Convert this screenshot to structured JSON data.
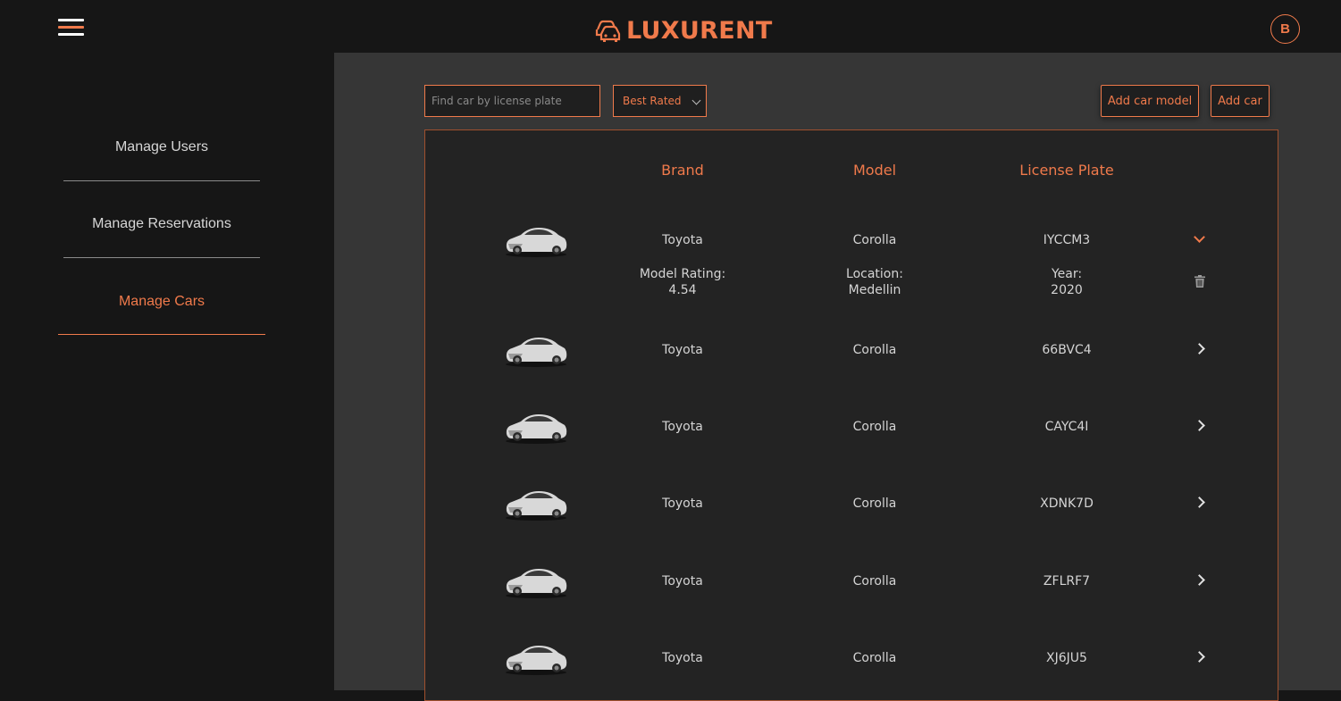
{
  "header": {
    "brand": "LUXURENT",
    "avatar_initial": "B"
  },
  "sidebar": {
    "items": [
      {
        "label": "Manage Users"
      },
      {
        "label": "Manage Reservations"
      },
      {
        "label": "Manage Cars"
      }
    ]
  },
  "toolbar": {
    "search_placeholder": "Find car by license plate",
    "sort_selected": "Best Rated",
    "add_model_label": "Add car model",
    "add_car_label": "Add car"
  },
  "table": {
    "headers": {
      "brand": "Brand",
      "model": "Model",
      "plate": "License Plate"
    },
    "rows": [
      {
        "brand": "Toyota",
        "model": "Corolla",
        "plate": "IYCCM3",
        "expanded": true,
        "details": {
          "rating_label": "Model Rating:",
          "rating": "4.54",
          "location_label": "Location:",
          "location": "Medellin",
          "year_label": "Year:",
          "year": "2020"
        }
      },
      {
        "brand": "Toyota",
        "model": "Corolla",
        "plate": "66BVC4"
      },
      {
        "brand": "Toyota",
        "model": "Corolla",
        "plate": "CAYC4I"
      },
      {
        "brand": "Toyota",
        "model": "Corolla",
        "plate": "XDNK7D"
      },
      {
        "brand": "Toyota",
        "model": "Corolla",
        "plate": "ZFLRF7"
      },
      {
        "brand": "Toyota",
        "model": "Corolla",
        "plate": "XJ6JU5"
      }
    ]
  },
  "colors": {
    "accent": "#f07a4b",
    "background": "#363636",
    "sidebar": "#161616",
    "table": "#232323"
  }
}
